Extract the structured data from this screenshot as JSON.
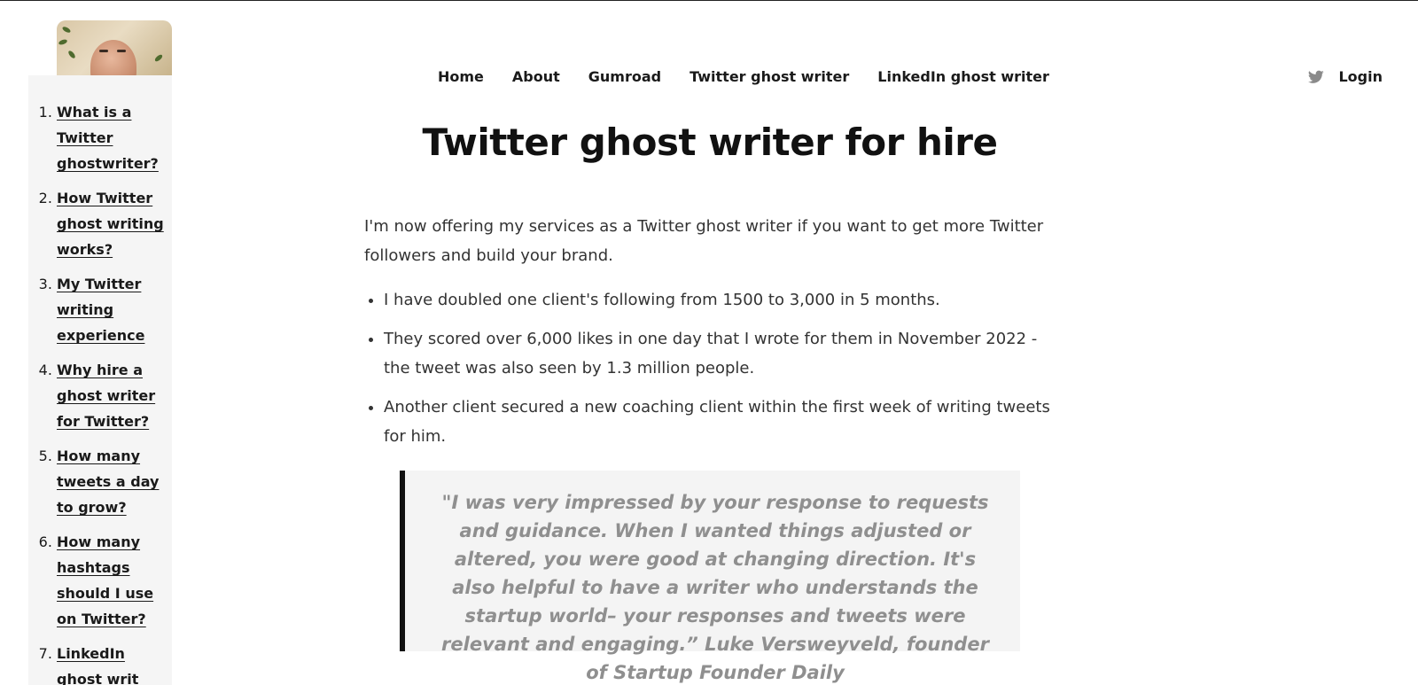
{
  "nav": {
    "links": [
      "Home",
      "About",
      "Gumroad",
      "Twitter ghost writer",
      "LinkedIn ghost writer"
    ],
    "login": "Login",
    "icons": [
      "twitter-icon"
    ]
  },
  "toc": {
    "items": [
      "What is a Twitter ghostwriter?",
      "How Twitter ghost writing works?",
      "My Twitter writing experience",
      "Why hire a ghost writer for Twitter?",
      "How many tweets a day to grow?",
      "How many hashtags should I use on Twitter?",
      "LinkedIn ghost writ"
    ]
  },
  "main": {
    "title": "Twitter ghost writer for hire",
    "intro": "I'm now offering my services as a Twitter ghost writer if you want to get more Twitter followers and build your brand.",
    "bullets": [
      "I have doubled one client's following from 1500 to 3,000 in 5 months.",
      "They scored over 6,000 likes in one day that I wrote for them in November 2022 - the tweet was also seen by 1.3 million people.",
      "Another client secured a new coaching client within the first week of writing tweets for him."
    ],
    "quote": "\"I was very impressed by your response to requests and guidance. When I wanted things adjusted or altered, you were good at changing direction. It's also helpful to have a writer who understands the startup world– your responses and tweets were relevant and engaging.” Luke Versweyveld, founder of Startup Founder Daily"
  },
  "colors": {
    "text": "#1a1a1a",
    "body_text": "#333333",
    "quote_text": "#8f8f8f",
    "quote_bg": "#f4f4f4",
    "toc_bg": "#f5f5f5"
  }
}
